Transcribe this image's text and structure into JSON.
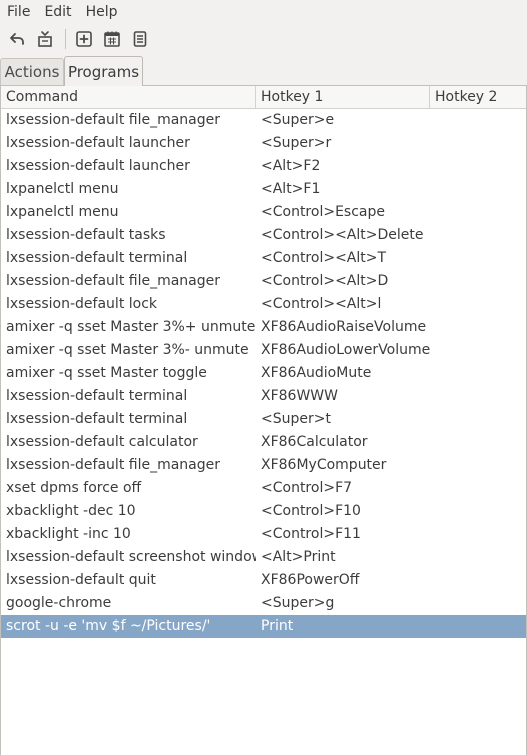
{
  "menubar": {
    "items": [
      {
        "label": "File"
      },
      {
        "label": "Edit"
      },
      {
        "label": "Help"
      }
    ]
  },
  "toolbar": {
    "buttons": [
      {
        "icon": "undo-icon"
      },
      {
        "icon": "reset-icon"
      },
      {
        "icon": "add-icon"
      },
      {
        "icon": "calendar-icon"
      },
      {
        "icon": "document-icon"
      }
    ]
  },
  "tabs": [
    {
      "label": "Actions",
      "active": false
    },
    {
      "label": "Programs",
      "active": true
    }
  ],
  "table": {
    "columns": [
      "Command",
      "Hotkey 1",
      "Hotkey 2"
    ],
    "rows": [
      {
        "command": "lxsession-default file_manager",
        "hotkey1": "<Super>e",
        "hotkey2": ""
      },
      {
        "command": "lxsession-default launcher",
        "hotkey1": "<Super>r",
        "hotkey2": ""
      },
      {
        "command": "lxsession-default launcher",
        "hotkey1": "<Alt>F2",
        "hotkey2": ""
      },
      {
        "command": "lxpanelctl menu",
        "hotkey1": "<Alt>F1",
        "hotkey2": ""
      },
      {
        "command": "lxpanelctl menu",
        "hotkey1": "<Control>Escape",
        "hotkey2": ""
      },
      {
        "command": "lxsession-default tasks",
        "hotkey1": "<Control><Alt>Delete",
        "hotkey2": ""
      },
      {
        "command": "lxsession-default terminal",
        "hotkey1": "<Control><Alt>T",
        "hotkey2": ""
      },
      {
        "command": "lxsession-default file_manager",
        "hotkey1": "<Control><Alt>D",
        "hotkey2": ""
      },
      {
        "command": "lxsession-default lock",
        "hotkey1": "<Control><Alt>l",
        "hotkey2": ""
      },
      {
        "command": "amixer -q sset Master 3%+ unmute",
        "hotkey1": "XF86AudioRaiseVolume",
        "hotkey2": ""
      },
      {
        "command": "amixer -q sset Master 3%- unmute",
        "hotkey1": "XF86AudioLowerVolume",
        "hotkey2": ""
      },
      {
        "command": "amixer -q sset Master toggle",
        "hotkey1": "XF86AudioMute",
        "hotkey2": ""
      },
      {
        "command": "lxsession-default terminal",
        "hotkey1": "XF86WWW",
        "hotkey2": ""
      },
      {
        "command": "lxsession-default terminal",
        "hotkey1": "<Super>t",
        "hotkey2": ""
      },
      {
        "command": "lxsession-default calculator",
        "hotkey1": "XF86Calculator",
        "hotkey2": ""
      },
      {
        "command": "lxsession-default file_manager",
        "hotkey1": "XF86MyComputer",
        "hotkey2": ""
      },
      {
        "command": "xset dpms force off",
        "hotkey1": "<Control>F7",
        "hotkey2": ""
      },
      {
        "command": "xbacklight -dec 10",
        "hotkey1": "<Control>F10",
        "hotkey2": ""
      },
      {
        "command": "xbacklight -inc 10",
        "hotkey1": "<Control>F11",
        "hotkey2": ""
      },
      {
        "command": "lxsession-default screenshot window",
        "hotkey1": "<Alt>Print",
        "hotkey2": ""
      },
      {
        "command": "lxsession-default quit",
        "hotkey1": "XF86PowerOff",
        "hotkey2": ""
      },
      {
        "command": "google-chrome",
        "hotkey1": "<Super>g",
        "hotkey2": ""
      },
      {
        "command": "scrot -u -e 'mv $f ~/Pictures/'",
        "hotkey1": "Print",
        "hotkey2": "",
        "selected": true
      }
    ]
  },
  "colors": {
    "selection": "#86a6c8",
    "window_bg": "#f2f1f0",
    "list_bg": "#ffffff"
  }
}
